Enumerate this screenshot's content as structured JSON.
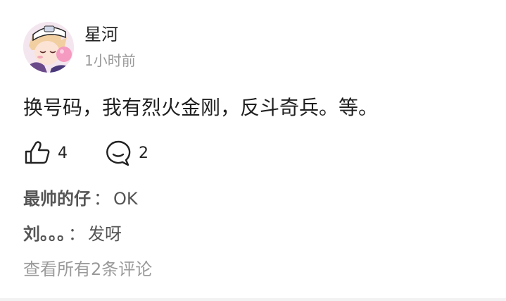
{
  "post": {
    "author": "星河",
    "time": "1小时前",
    "content": "换号码，我有烈火金刚，反斗奇兵。等。"
  },
  "actions": {
    "like_icon": "thumbs-up-icon",
    "like_count": "4",
    "comment_icon": "comment-bubble-icon",
    "comment_count": "2"
  },
  "comments": [
    {
      "author": "最帅的仔",
      "separator": "：",
      "text": "OK"
    },
    {
      "author": "刘。。。",
      "separator": "：",
      "text": "发呀"
    }
  ],
  "view_all": "查看所有2条评论",
  "colors": {
    "text_primary": "#222222",
    "text_secondary": "#9a9a9a",
    "comment_text": "#555555",
    "divider": "#f2f2f2"
  }
}
